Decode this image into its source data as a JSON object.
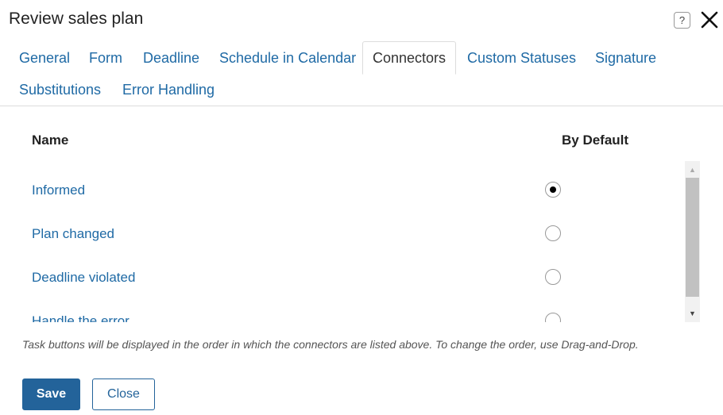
{
  "dialog": {
    "title": "Review sales plan",
    "help_label": "?"
  },
  "tabs": [
    {
      "label": "General"
    },
    {
      "label": "Form"
    },
    {
      "label": "Deadline"
    },
    {
      "label": "Schedule in Calendar"
    },
    {
      "label": "Connectors",
      "active": true
    },
    {
      "label": "Custom Statuses"
    },
    {
      "label": "Signature"
    },
    {
      "label": "Substitutions"
    },
    {
      "label": "Error Handling"
    }
  ],
  "table": {
    "col_name": "Name",
    "col_default": "By Default",
    "rows": [
      {
        "name": "Informed",
        "default": true
      },
      {
        "name": "Plan changed",
        "default": false
      },
      {
        "name": "Deadline violated",
        "default": false
      },
      {
        "name": "Handle the error",
        "default": false
      }
    ]
  },
  "hint": "Task buttons will be displayed in the order in which the connectors are listed above. To change the order, use Drag-and-Drop.",
  "buttons": {
    "save": "Save",
    "close": "Close"
  },
  "colors": {
    "link": "#1f6aa5",
    "primary": "#23639a"
  },
  "icons": {
    "help": "question-icon",
    "close": "close-x-icon",
    "scroll_up": "triangle-up-icon",
    "scroll_down": "triangle-down-icon"
  }
}
